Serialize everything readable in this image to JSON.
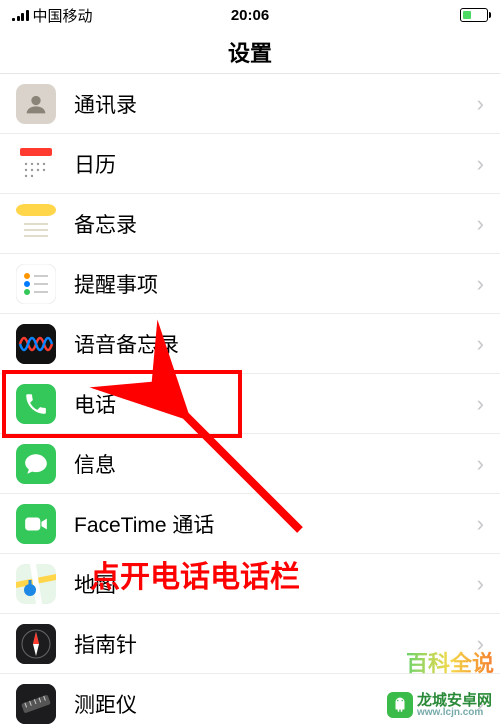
{
  "status": {
    "carrier": "中国移动",
    "time": "20:06",
    "battery_pct": 35,
    "battery_color": "#4cd964"
  },
  "header": {
    "title": "设置"
  },
  "rows": [
    {
      "id": "contacts",
      "label": "通讯录",
      "icon_bg": "#d9d3cb",
      "glyph": "contacts"
    },
    {
      "id": "calendar",
      "label": "日历",
      "icon_bg": "#ffffff",
      "glyph": "calendar"
    },
    {
      "id": "notes",
      "label": "备忘录",
      "icon_bg": "#fff8dc",
      "glyph": "notes"
    },
    {
      "id": "reminders",
      "label": "提醒事项",
      "icon_bg": "#ffffff",
      "glyph": "reminders"
    },
    {
      "id": "voicememo",
      "label": "语音备忘录",
      "icon_bg": "#111111",
      "glyph": "voicememo"
    },
    {
      "id": "phone",
      "label": "电话",
      "icon_bg": "#34c759",
      "glyph": "phone"
    },
    {
      "id": "messages",
      "label": "信息",
      "icon_bg": "#34c759",
      "glyph": "messages"
    },
    {
      "id": "facetime",
      "label": "FaceTime 通话",
      "icon_bg": "#34c759",
      "glyph": "facetime"
    },
    {
      "id": "maps",
      "label": "地图",
      "icon_bg": "#ffffff",
      "glyph": "maps"
    },
    {
      "id": "compass",
      "label": "指南针",
      "icon_bg": "#1c1c1e",
      "glyph": "compass"
    },
    {
      "id": "measure",
      "label": "测距仪",
      "icon_bg": "#1c1c1e",
      "glyph": "measure"
    }
  ],
  "annotation": {
    "text": "点开电话电话栏",
    "highlight_row": "phone"
  },
  "watermark": {
    "top": "百科全说",
    "brand": "龙城安卓网",
    "url": "www.lcjn.com"
  }
}
